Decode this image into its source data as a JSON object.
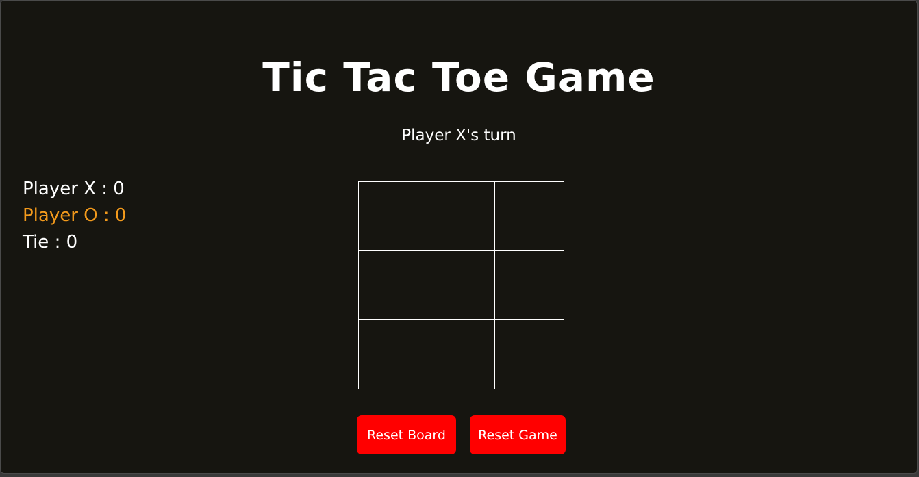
{
  "title": "Tic Tac Toe Game",
  "status": "Player X's turn",
  "scores": {
    "x_label": "Player X : 0",
    "o_label": "Player O : 0",
    "tie_label": "Tie : 0"
  },
  "board": {
    "cells": [
      "",
      "",
      "",
      "",
      "",
      "",
      "",
      "",
      ""
    ]
  },
  "buttons": {
    "reset_board": "Reset Board",
    "reset_game": "Reset Game"
  },
  "colors": {
    "background": "#161510",
    "text": "#ffffff",
    "player_o": "#f39a1c",
    "button": "#ff0000"
  }
}
